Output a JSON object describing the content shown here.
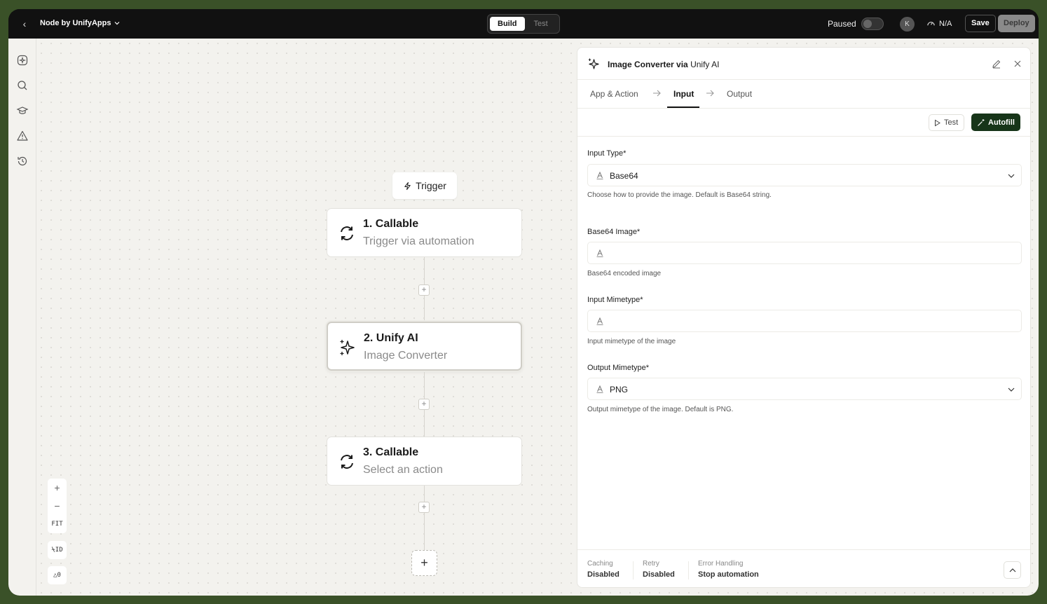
{
  "header": {
    "app_title": "Node by UnifyApps",
    "modes": [
      "Build",
      "Test"
    ],
    "active_mode": "Build",
    "paused_label": "Paused",
    "avatar_initial": "K",
    "perf_label": "N/A",
    "save_label": "Save",
    "deploy_label": "Deploy"
  },
  "rail": {
    "items": [
      "sparkle-badge-icon",
      "search-icon",
      "graduation-cap-icon",
      "warning-icon",
      "history-icon"
    ]
  },
  "canvas": {
    "trigger_label": "Trigger",
    "nodes": [
      {
        "title": "1. Callable",
        "subtitle": "Trigger via automation",
        "icon": "refresh-icon"
      },
      {
        "title": "2. Unify AI",
        "subtitle": "Image Converter",
        "icon": "sparkles-icon",
        "selected": true
      },
      {
        "title": "3. Callable",
        "subtitle": "Select an action",
        "icon": "refresh-icon"
      }
    ],
    "zoom": {
      "in": "+",
      "out": "−",
      "fit": "FIT"
    },
    "id_toggle": "ID",
    "warning_count": "0"
  },
  "panel": {
    "title_prefix": "Image Converter via ",
    "title_app": "Unify AI",
    "steps": [
      "App & Action",
      "Input",
      "Output"
    ],
    "active_step": "Input",
    "test_label": "Test",
    "autofill_label": "Autofill",
    "fields": [
      {
        "label": "Input Type*",
        "value": "Base64",
        "placeholder": "",
        "helper": "Choose how to provide the image. Default is Base64 string.",
        "type": "select"
      },
      {
        "label": "Base64 Image*",
        "value": "",
        "placeholder": "",
        "helper": "Base64 encoded image",
        "type": "text"
      },
      {
        "label": "Input Mimetype*",
        "value": "",
        "placeholder": "",
        "helper": "Input mimetype of the image",
        "type": "text"
      },
      {
        "label": "Output Mimetype*",
        "value": "PNG",
        "placeholder": "",
        "helper": "Output mimetype of the image. Default is PNG.",
        "type": "select"
      }
    ],
    "footer": [
      {
        "key": "Caching",
        "value": "Disabled"
      },
      {
        "key": "Retry",
        "value": "Disabled"
      },
      {
        "key": "Error Handling",
        "value": "Stop automation"
      }
    ]
  },
  "colors": {
    "accent": "#173519",
    "topbar": "#111111",
    "canvas": "#f3f2ee"
  }
}
